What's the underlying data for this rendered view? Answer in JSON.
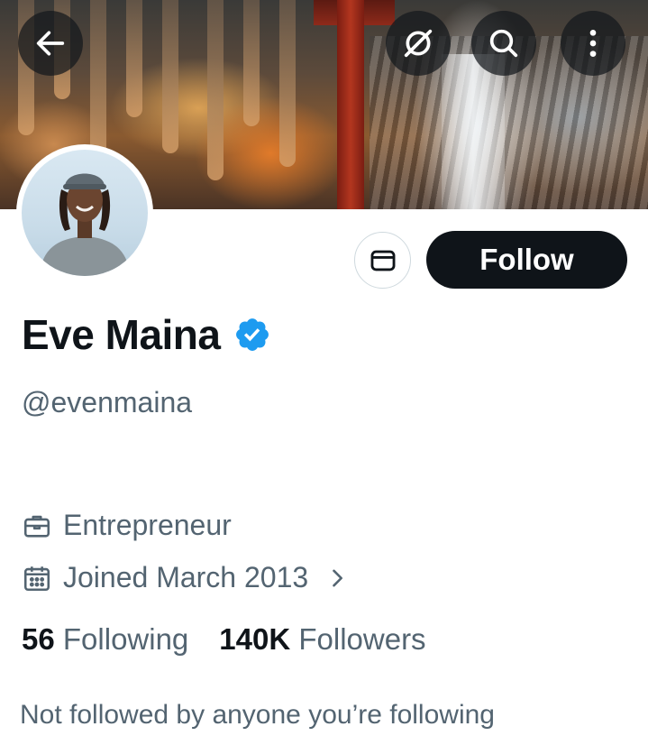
{
  "header": {
    "icons": {
      "back": "arrow-left-icon",
      "grok": "grok-icon",
      "search": "search-icon",
      "more": "more-vertical-icon"
    }
  },
  "profile": {
    "display_name": "Eve Maina",
    "verified": true,
    "handle": "@evenmaina",
    "occupation": "Entrepreneur",
    "joined": "Joined March 2013",
    "following_count": "56",
    "following_label": "Following",
    "followers_count": "140K",
    "followers_label": "Followers",
    "social_context": "Not followed by anyone you’re following"
  },
  "actions": {
    "follow_label": "Follow",
    "message_icon": "envelope-icon"
  },
  "colors": {
    "follow_bg": "#0f1419",
    "verified_blue": "#1d9bf0",
    "secondary_text": "#536471"
  }
}
